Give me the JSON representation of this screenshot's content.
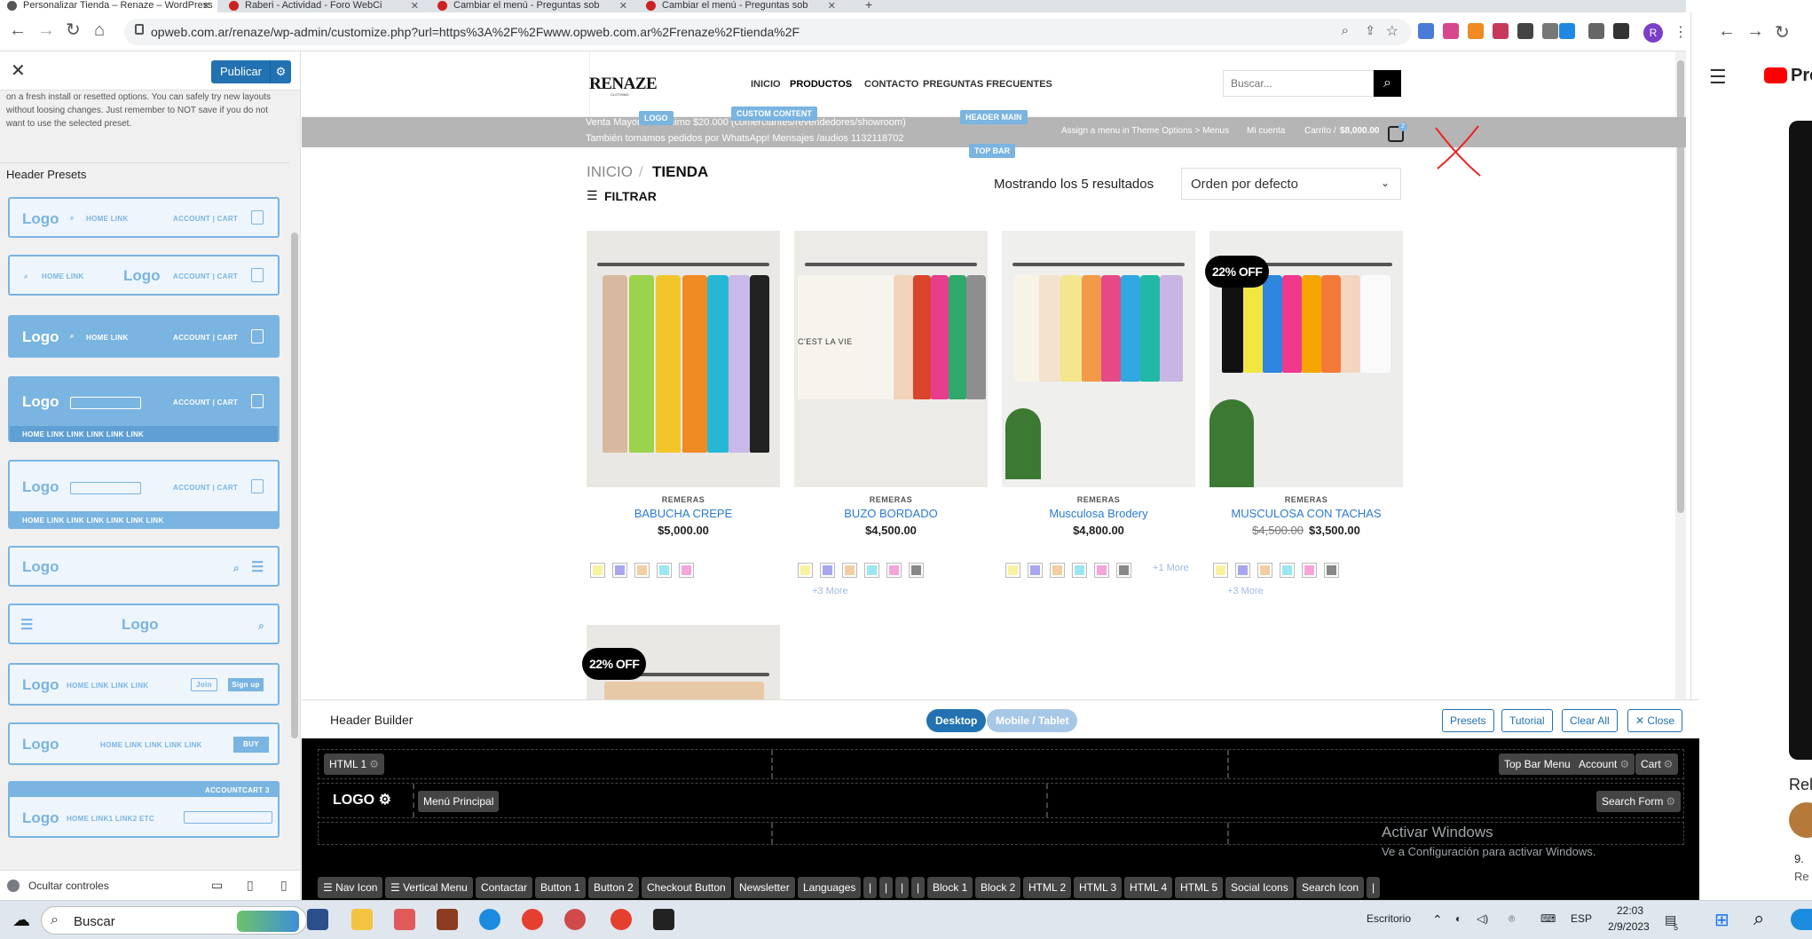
{
  "browser": {
    "tabs": [
      {
        "label": "Personalizar Tienda – Renaze – WordPress"
      },
      {
        "label": "Raberi - Actividad - Foro WebCi"
      },
      {
        "label": "Cambiar el menú - Preguntas sob"
      },
      {
        "label": "Cambiar el menú - Preguntas sob"
      }
    ],
    "url": "opweb.com.ar/renaze/wp-admin/customize.php?url=https%3A%2F%2Fwww.opweb.com.ar%2Frenaze%2Ftienda%2F",
    "profile_initial": "R"
  },
  "youtube": {
    "logo_text": "Pre",
    "related_label": "Rel",
    "stat1": "9.",
    "stat2": "Re"
  },
  "customizer": {
    "publish_label": "Publicar",
    "note": "on a fresh install or resetted options. You can safely try new layouts without loosing changes. Just remember to NOT save if you do not want to use the selected preset.",
    "presets_heading": "Header Presets",
    "preset_logo": "Logo",
    "preset_text": {
      "home_link": "HOME  LINK",
      "account_cart": "ACCOUNT | CART",
      "account_cart_bold": "ACCOUNT | CART",
      "nav_row4": "HOME LINK     LINK  LINK  LINK  LINK",
      "nav_row5": "HOME    LINK    LINK    LINK    LINK    LINK    LINK",
      "nav_long": "HOME    LINK    LINK    LINK",
      "join": "Join",
      "signup": "Sign up",
      "nav_long5": "HOME    LINK    LINK    LINK    LINK",
      "buy": "BUY",
      "account": "ACCOUNT",
      "cart": "CART",
      "nav_etc": "HOME    LINK1    LINK2    ETC",
      "cart_count": "3"
    },
    "hide_controls": "Ocultar controles"
  },
  "site": {
    "logo_text": "RENAZE",
    "logo_sub": "CLOTHING",
    "nav": [
      "INICIO",
      "PRODUCTOS",
      "CONTACTO",
      "PREGUNTAS FRECUENTES"
    ],
    "search_placeholder": "Buscar...",
    "topbar_line1": "Venta Mayorista mínimo $20.000      (comerciantes/revendedores/showroom)",
    "topbar_line2": "También tomamos pedidos por WhatsApp! Mensajes /audios 1132118702",
    "topbar_right": [
      "Assign a menu in Theme Options > Menus",
      "Mi cuenta"
    ],
    "cart_label": "Carrito /",
    "cart_amount": "$8,000.00",
    "cart_count": "2",
    "tags": {
      "logo": "LOGO",
      "custom": "CUSTOM CONTENT",
      "header_main": "HEADER MAIN",
      "top_bar": "TOP BAR"
    },
    "breadcrumb_home": "INICIO",
    "breadcrumb_sep": "/",
    "breadcrumb_current": "TIENDA",
    "filter_label": "FILTRAR",
    "results_text": "Mostrando los 5 resultados",
    "sort_selected": "Orden por defecto",
    "products": [
      {
        "category": "REMERAS",
        "name": "BABUCHA CREPE",
        "price": "$5,000.00",
        "old_price": "",
        "more": ""
      },
      {
        "category": "REMERAS",
        "name": "BUZO BORDADO",
        "price": "$4,500.00",
        "old_price": "",
        "more": "+3 More"
      },
      {
        "category": "REMERAS",
        "name": "Musculosa Brodery",
        "price": "$4,800.00",
        "old_price": "",
        "more": "+1 More"
      },
      {
        "category": "REMERAS",
        "name": "MUSCULOSA CON TACHAS",
        "price": "$3,500.00",
        "old_price": "$4,500.00",
        "more": "+3 More"
      }
    ],
    "sale_badge": "22% OFF",
    "shirt_print": "C'EST LA VIE"
  },
  "header_builder": {
    "title": "Header Builder",
    "desktop_label": "Desktop",
    "mobile_label": "Mobile / Tablet",
    "buttons": [
      "Presets",
      "Tutorial",
      "Clear All",
      "Close"
    ],
    "row1_left": "HTML 1",
    "row1_right": [
      "Top Bar Menu",
      "Account",
      "Cart"
    ],
    "row2_logo": "LOGO",
    "row2_menu": "Menú Principal",
    "row2_right": "Search Form",
    "available": [
      "Nav Icon",
      "Vertical Menu",
      "Contactar",
      "Button 1",
      "Button 2",
      "Checkout Button",
      "Newsletter",
      "Languages",
      "|",
      "|",
      "|",
      "|",
      "Block 1",
      "Block 2",
      "HTML 2",
      "HTML 3",
      "HTML 4",
      "HTML 5",
      "Social Icons",
      "Search Icon",
      "|"
    ]
  },
  "windows": {
    "activate_title": "Activar Windows",
    "activate_sub": "Ve a Configuración para activar Windows.",
    "search_placeholder": "Buscar",
    "desktop_label": "Escritorio",
    "lang": "ESP",
    "time": "22:03",
    "date": "2/9/2023",
    "notif_count": "5"
  }
}
